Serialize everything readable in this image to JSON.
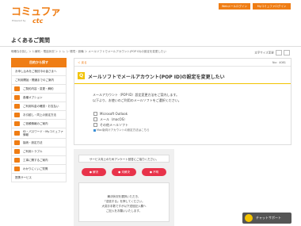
{
  "header": {
    "logo_text": "コミュファ",
    "logo_subtext": "Powered by",
    "logo_brand": "ctc",
    "buttons": [
      "Webメールログイン",
      "Myコミュファログイン"
    ]
  },
  "page_title": "よくあるご質問",
  "breadcrumb": "明確なお探し ＞ 1.解約・電話状況 ＞ ト レ シ 環境・設備 ＞ メールソフトでメールアカウント(POP ID)の設定を変更したい",
  "font_size_label": "文字サイズ変更",
  "sidebar": {
    "header": "目的から探す",
    "items": [
      {
        "label": "お申し込みをご検討中の皆さまへ",
        "icon": false
      },
      {
        "label": "ご利用開始・開通までのご案内",
        "icon": false
      },
      {
        "label": "ご契約内容・変更・解約",
        "icon": true
      },
      {
        "label": "各種オプション",
        "icon": true
      },
      {
        "label": "ご利用料金の確認・お支払い",
        "icon": true
      },
      {
        "label": "お引越し・同上の設定方法",
        "icon": true
      },
      {
        "label": "ご依頼情報のご案内",
        "icon": true
      },
      {
        "label": "ID・パスワード・Myコミュファ情報",
        "icon": true
      },
      {
        "label": "接続・設定方法",
        "icon": true
      },
      {
        "label": "ご利用トラブル",
        "icon": true
      },
      {
        "label": "工事に関するご案内",
        "icon": true
      },
      {
        "label": "わかりにくいご質問",
        "icon": true
      },
      {
        "label": "提携サービス",
        "icon": false
      }
    ]
  },
  "main": {
    "back_label": "＜ 戻る",
    "faq_number": "No：4081",
    "q_badge": "Q",
    "question": "メールソフトでメールアカウント(POP ID)の設定を変更したい",
    "answer_lines": [
      "メールアカウント（POP ID）設定変更方法をご案内します。",
      "以下より、お使いのご利用のメールソフトをご選択ください。"
    ],
    "options": [
      "Microsoft Outlook",
      "メール（macOS）",
      "その他メールソフト"
    ],
    "help_link": "Mac版向けアカウントの設定方法はこちら"
  },
  "survey": {
    "header": "サービス向上のためアンケート回答にご協力ください。",
    "buttons": [
      {
        "label": "● 解決",
        "color": "#e8334a"
      },
      {
        "label": "● 未解決",
        "color": "#e8334a"
      },
      {
        "label": "● 不明",
        "color": "#e8334a"
      }
    ],
    "lines": [
      "解決状況を選択いただき、",
      "「送信する」を押してください。",
      "大変お手数ですが以下送信記入欄へ",
      "ご記入をお願いいたします。"
    ]
  },
  "chat": {
    "label": "チャットサポート"
  },
  "colors": {
    "brand": "#ef7d14",
    "q_badge": "#f2c300",
    "survey_button": "#e8334a"
  }
}
